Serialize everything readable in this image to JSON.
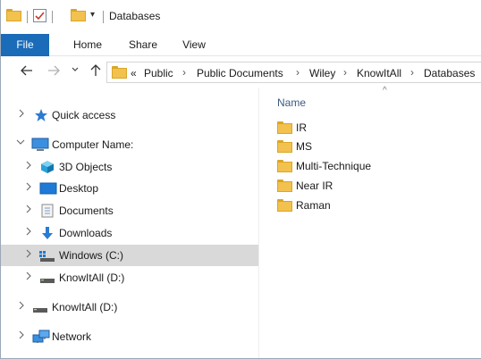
{
  "titlebar": {
    "title": "Databases"
  },
  "ribbon": {
    "tabs": [
      {
        "label": "File"
      },
      {
        "label": "Home"
      },
      {
        "label": "Share"
      },
      {
        "label": "View"
      }
    ]
  },
  "address": {
    "overflow": "«",
    "crumbs": [
      "Public",
      "Public Documents",
      "Wiley",
      "KnowItAll",
      "Databases"
    ]
  },
  "nav": {
    "items": [
      {
        "label": "Quick access",
        "icon": "star-icon"
      },
      {
        "label": "Computer Name:",
        "icon": "computer-icon"
      },
      {
        "label": "3D Objects",
        "icon": "cube-icon"
      },
      {
        "label": "Desktop",
        "icon": "desktop-icon"
      },
      {
        "label": "Documents",
        "icon": "document-icon"
      },
      {
        "label": "Downloads",
        "icon": "download-arrow-icon"
      },
      {
        "label": "Windows (C:)",
        "icon": "drive-icon",
        "selected": true
      },
      {
        "label": "KnowItAll (D:)",
        "icon": "drive-icon"
      },
      {
        "label": "KnowItAll (D:)",
        "icon": "drive-icon"
      },
      {
        "label": "Network",
        "icon": "network-icon"
      }
    ]
  },
  "content": {
    "column_header": "Name",
    "folders": [
      "IR",
      "MS",
      "Multi-Technique",
      "Near IR",
      "Raman"
    ]
  },
  "colors": {
    "file_tab": "#1a6bb8",
    "folder": "#f2c14e",
    "selected_row": "#d9d9d9"
  }
}
